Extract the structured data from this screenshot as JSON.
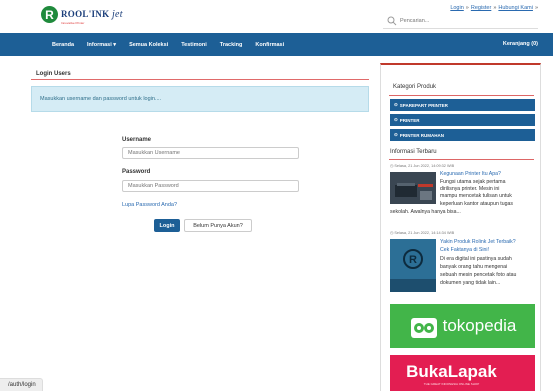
{
  "brand": {
    "logo_letter": "R",
    "name": "ROOL'INK",
    "name_suffix": "jet",
    "tagline": "Innovative Printer"
  },
  "toplinks": {
    "login": "Login",
    "register": "Register",
    "contact": "Hubungi Kami",
    "sep": "»"
  },
  "search": {
    "placeholder": "Pencarian..."
  },
  "nav": {
    "items": [
      "Beranda",
      "Informasi ▾",
      "Semua Koleksi",
      "Testimoni",
      "Tracking",
      "Konfirmasi"
    ],
    "cart": "Keranjang (0)"
  },
  "main": {
    "title": "Login Users",
    "alert": "Masukkan username dan password untuk login....",
    "username_label": "Username",
    "username_placeholder": "Masukkan Username",
    "password_label": "Password",
    "password_placeholder": "Masukkan Password",
    "forgot": "Lupa Password Anda?",
    "login_button": "Login",
    "register_button": "Belum Punya Akun?"
  },
  "sidebar": {
    "category_title": "Kategori Produk",
    "categories": [
      "SPAREPART PRINTER",
      "PRINTER",
      "PRINTER RUMAHAN"
    ],
    "info_title": "Informasi Terbaru",
    "articles": [
      {
        "date": "Selasa, 21 Jun 2022, 14:09:32 WIB",
        "title": "Kegunaan Printer Itu Apa?",
        "text1": "Fungsi utama sejak pertama",
        "text2": "dirilisnya printer. Mesin ini",
        "text3": "mampu mencetak tulisan untuk",
        "text4": "keperluan kantor ataupun tugas",
        "text5": "sekolah. Awalnya hanya bisa..."
      },
      {
        "date": "Selasa, 21 Jun 2022, 14:14:34 WIB",
        "title1": "Yakin Produk Rolink Jet Terbaik?",
        "title2": "Cek Faktanya di Sini!",
        "text1": "Di era digital ini pastinya sudah",
        "text2": "banyak orang tahu mengenai",
        "text3": "sebuah mesin pencetak foto atau",
        "text4": "dokumen yang tidak lain..."
      }
    ],
    "banner1": "tokopedia",
    "banner2": "BukaLapak",
    "banner2_sub": "THE GREAT INDONESIA ONLINE SHOP"
  },
  "status_url": "/auth/login",
  "colors": {
    "primary": "#1d5f96",
    "accent_red": "#c0392b",
    "tokopedia": "#42b549",
    "bukalapak": "#e31e52"
  }
}
